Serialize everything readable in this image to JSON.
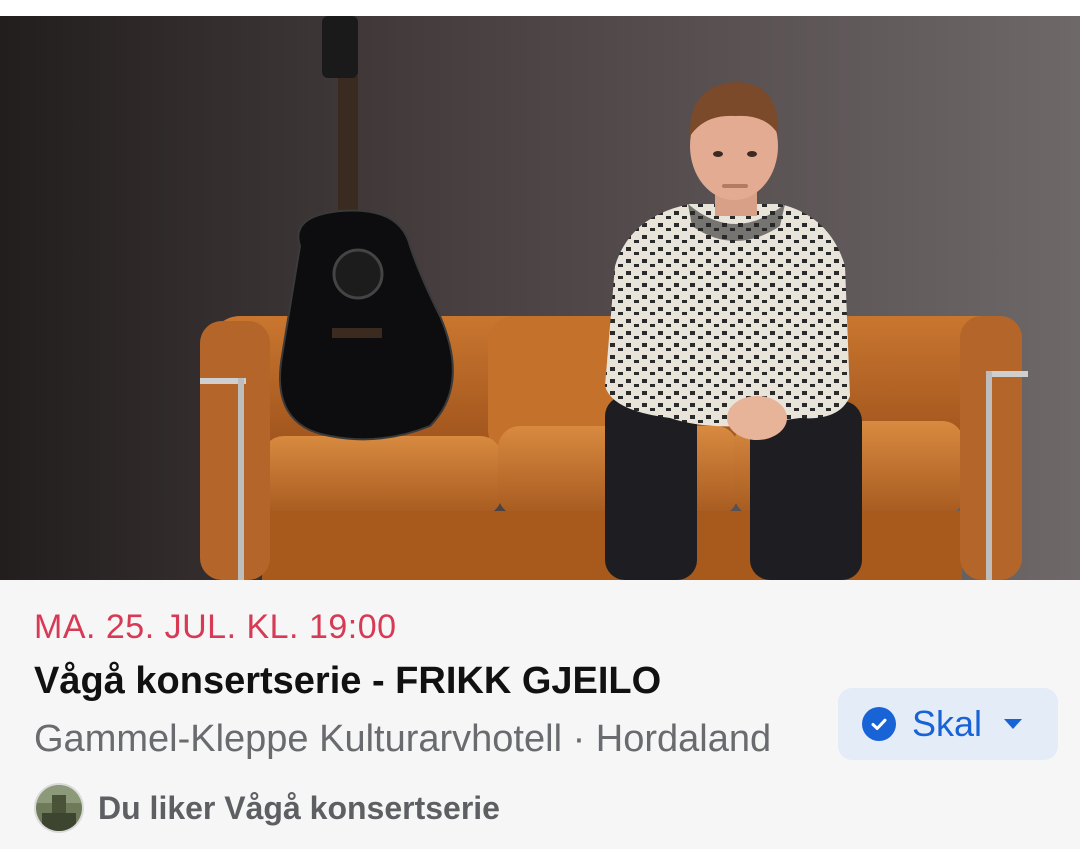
{
  "event": {
    "date": "MA. 25. JUL. KL. 19:00",
    "title": "Vågå konsertserie - FRIKK GJEILO",
    "location": "Gammel-Kleppe Kulturarvhotell · Hordaland",
    "liked_by": "Du liker Vågå konsertserie"
  },
  "rsvp": {
    "label": "Skal",
    "icon": "check-circle-icon",
    "dropdown_icon": "caret-down-icon"
  },
  "colors": {
    "date": "#d73a55",
    "accent": "#1863d6",
    "button_bg": "#e4ecf8",
    "info_bg": "#f6f6f7"
  }
}
